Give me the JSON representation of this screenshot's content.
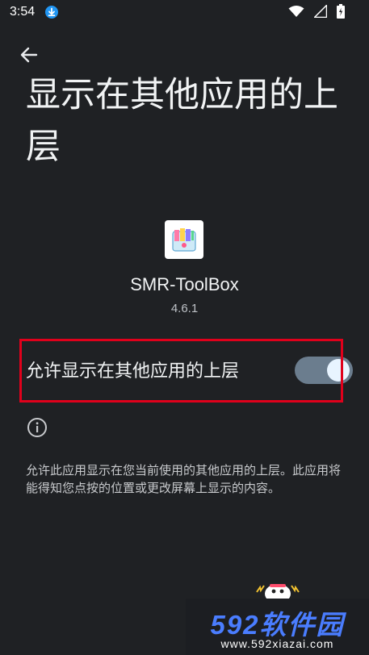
{
  "status_bar": {
    "time": "3:54"
  },
  "page": {
    "title": "显示在其他应用的上层"
  },
  "app": {
    "name": "SMR-ToolBox",
    "version": "4.6.1"
  },
  "setting": {
    "label": "允许显示在其他应用的上层",
    "enabled": true
  },
  "info": {
    "description": "允许此应用显示在您当前使用的其他应用的上层。此应用将能得知您点按的位置或更改屏幕上显示的内容。"
  },
  "watermark": {
    "logo": "592软件园",
    "url": "www.592xiazai.com"
  },
  "colors": {
    "background": "#1f2124",
    "switch_track": "#6b7d8e",
    "highlight": "#e0001b",
    "watermark_blue": "#4a7dff"
  },
  "icons": [
    "download-icon",
    "wifi-icon",
    "signal-icon",
    "battery-icon",
    "back-arrow-icon",
    "app-icon",
    "info-icon"
  ]
}
